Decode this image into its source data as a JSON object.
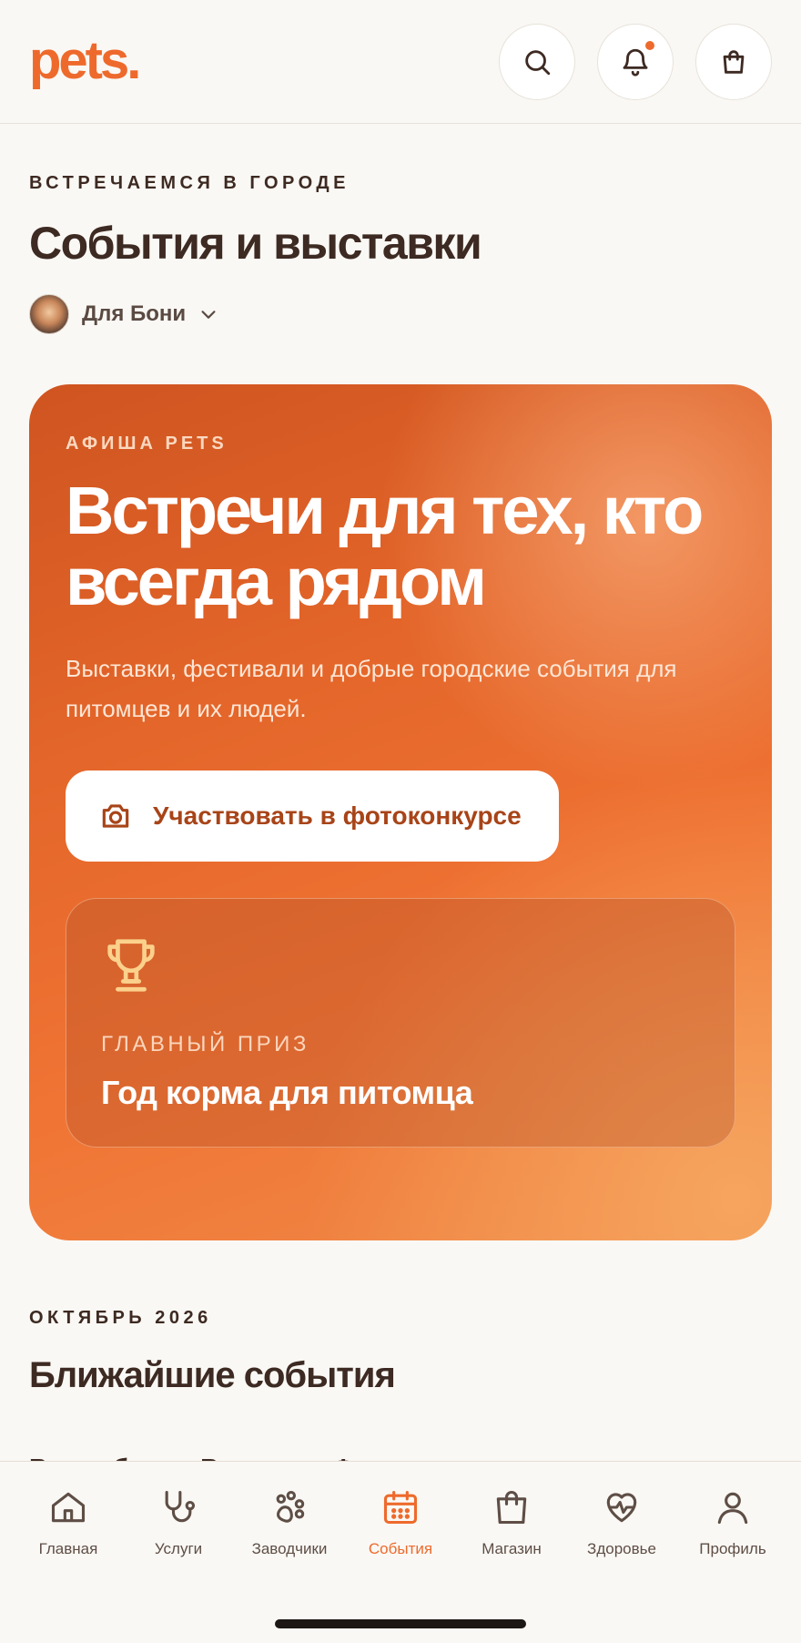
{
  "header": {
    "logo": "pets.",
    "icons": [
      "search-icon",
      "bell-icon",
      "bag-icon"
    ],
    "accent_color": "#ee6a2c"
  },
  "page": {
    "eyebrow": "ВСТРЕЧАЕМСЯ В ГОРОДЕ",
    "title": "События и выставки",
    "pet_selector": "Для Бони"
  },
  "hero": {
    "eyebrow": "АФИША PETS",
    "title": "Встречи для тех, кто всегда рядом",
    "subtitle": "Выставки, фестивали и добрые городские события для питомцев и их людей.",
    "cta_label": "Участвовать в фотоконкурсе",
    "prize_eyebrow": "ГЛАВНЫЙ ПРИЗ",
    "prize_title": "Год корма для питомца"
  },
  "upcoming": {
    "eyebrow": "ОКТЯБРЬ 2026",
    "title": "Ближайшие события",
    "partial_text": "Все события   Выставки   Фестивали"
  },
  "nav": {
    "items": [
      {
        "label": "Главная",
        "icon": "home-icon"
      },
      {
        "label": "Услуги",
        "icon": "stethoscope-icon"
      },
      {
        "label": "Заводчики",
        "icon": "paw-icon"
      },
      {
        "label": "События",
        "icon": "calendar-icon",
        "active": true
      },
      {
        "label": "Магазин",
        "icon": "bag-icon"
      },
      {
        "label": "Здоровье",
        "icon": "heart-pulse-icon"
      },
      {
        "label": "Профиль",
        "icon": "user-icon"
      }
    ]
  }
}
